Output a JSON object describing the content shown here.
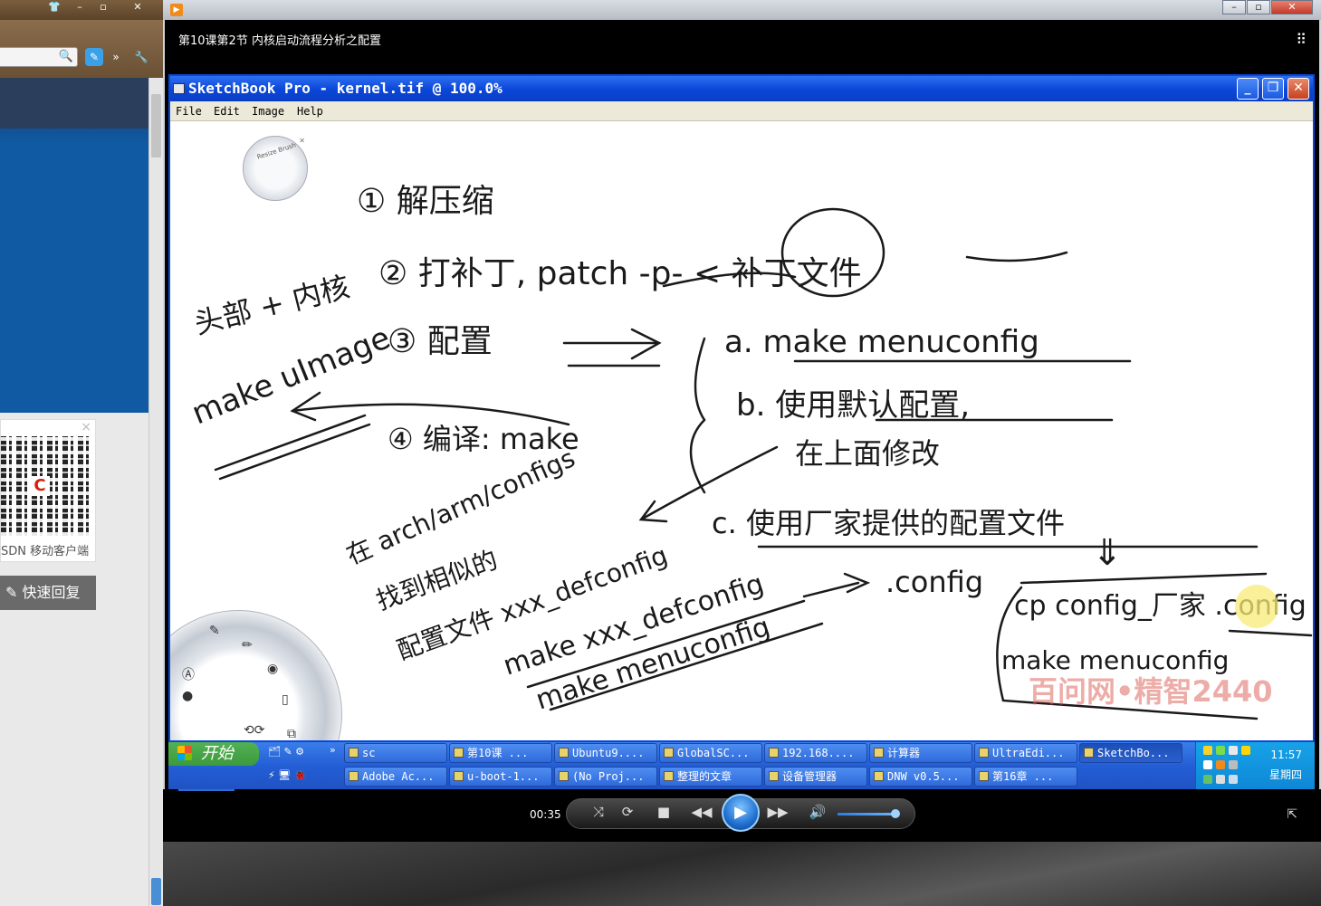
{
  "player": {
    "video_title": "第10课第2节 内核启动流程分析之配置",
    "time": "00:35",
    "progress": 0.05,
    "volume": 0.9
  },
  "browser": {
    "qr_caption": "SDN 移动客户端",
    "reply_label": "快速回复"
  },
  "sketchbook": {
    "title": "SketchBook Pro - kernel.tif @ 100.0%",
    "menu": [
      "File",
      "Edit",
      "Image",
      "Help"
    ],
    "brush_label": "Resize Brush",
    "watermark": "百问网•精智2440",
    "notes": {
      "n1": "① 解压缩",
      "n2": "② 打补丁, patch -p- < 补丁文件",
      "n3": "③ 配置",
      "n3a": "a. make menuconfig",
      "n3b": "b. 使用默认配置,",
      "n3b2": "在上面修改",
      "n3c": "c. 使用厂家提供的配置文件",
      "n4": "④ 编译: make",
      "side1": "头部 + 内核",
      "side2": "make uImage",
      "cfg1": "在 arch/arm/configs",
      "cfg2": "找到相似的",
      "cfg3": "配置文件 xxx_defconfig",
      "mk1": "make xxx_defconfig",
      "mk2": "make menuconfig",
      "dotconfig": ".config",
      "arrow_down": "⇓",
      "cp": "cp config_厂家 .config",
      "mk3": "make menuconfig"
    }
  },
  "taskbar": {
    "start_label": "开始",
    "row1": [
      "sc",
      "第10课 ...",
      "Ubuntu9....",
      "GlobalSC...",
      "192.168....",
      "计算器",
      "UltraEdi...",
      "SketchBo..."
    ],
    "row2": [
      "Adobe Ac...",
      "u-boot-1...",
      "(No Proj...",
      "整理的文章",
      "设备管理器",
      "DNW v0.5...",
      "第16章 ..."
    ],
    "clock_time": "11:57",
    "clock_day": "星期四"
  }
}
